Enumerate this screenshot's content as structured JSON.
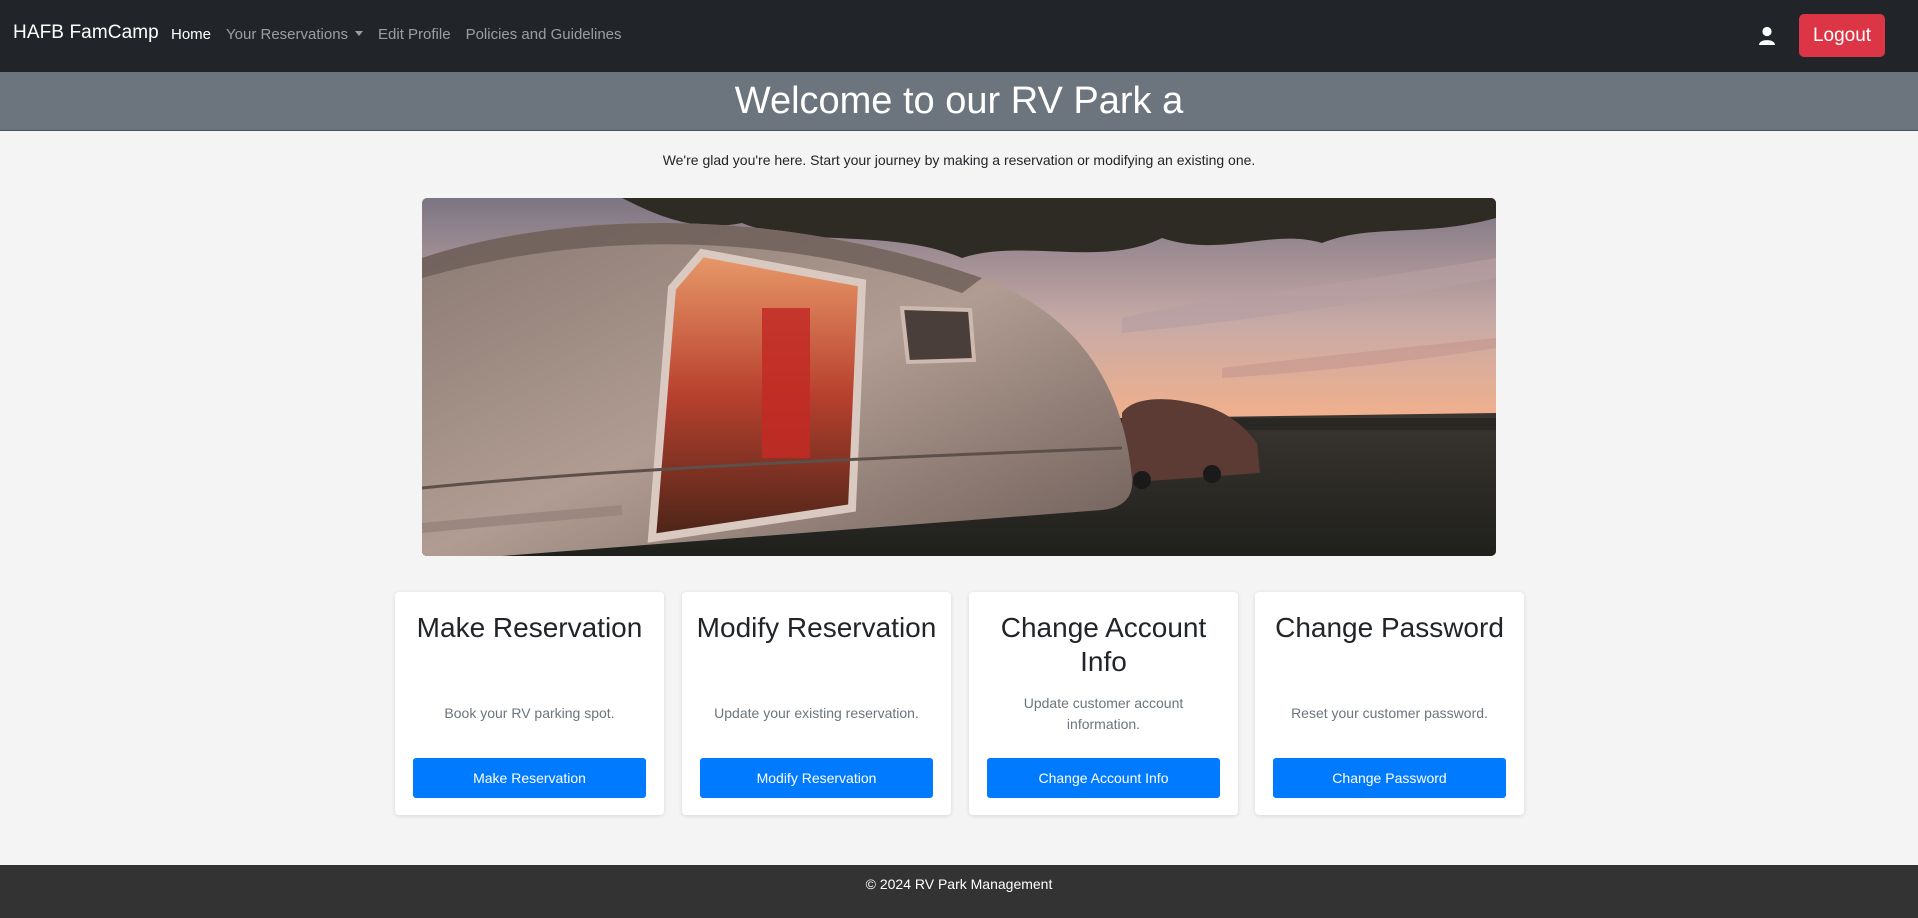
{
  "navbar": {
    "brand": "HAFB FamCamp",
    "links": [
      {
        "label": "Home",
        "active": true
      },
      {
        "label": "Your Reservations",
        "dropdown": true
      },
      {
        "label": "Edit Profile"
      },
      {
        "label": "Policies and Guidelines"
      }
    ],
    "user_icon": "user-icon",
    "logout_label": "Logout"
  },
  "hero": {
    "title": "Welcome to our RV Park a"
  },
  "intro_text": "We're glad you're here. Start your journey by making a reservation or modifying an existing one.",
  "photo": {
    "subject": "camper-trailer-at-sunset"
  },
  "cards": [
    {
      "title": "Make Reservation",
      "text": "Book your RV parking spot.",
      "button": "Make Reservation"
    },
    {
      "title": "Modify Reservation",
      "text": "Update your existing reservation.",
      "button": "Modify Reservation"
    },
    {
      "title": "Change Account Info",
      "text": "Update customer account information.",
      "button": "Change Account Info"
    },
    {
      "title": "Change Password",
      "text": "Reset your customer password.",
      "button": "Change Password"
    }
  ],
  "footer": {
    "text": "© 2024 RV Park Management"
  },
  "colors": {
    "navbar_bg": "#212529",
    "hero_bg": "#6c757d",
    "logout_red": "#dc3545",
    "primary_blue": "#007bff",
    "footer_bg": "#333333"
  }
}
